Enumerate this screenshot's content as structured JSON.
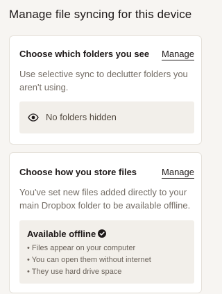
{
  "page": {
    "title": "Manage file syncing for this device"
  },
  "folders_card": {
    "title": "Choose which folders you see",
    "manage_label": "Manage",
    "description": "Use selective sync to declutter folders you aren't using.",
    "status_icon": "eye-icon",
    "status_text": "No folders hidden"
  },
  "storage_card": {
    "title": "Choose how you store files",
    "manage_label": "Manage",
    "description": "You've set new files added directly to your main Dropbox folder to be available offline.",
    "mode_title": "Available offline",
    "mode_icon": "check-circle-icon",
    "bullets": [
      "Files appear on your computer",
      "You can open them without internet",
      "They use hard drive space"
    ]
  }
}
